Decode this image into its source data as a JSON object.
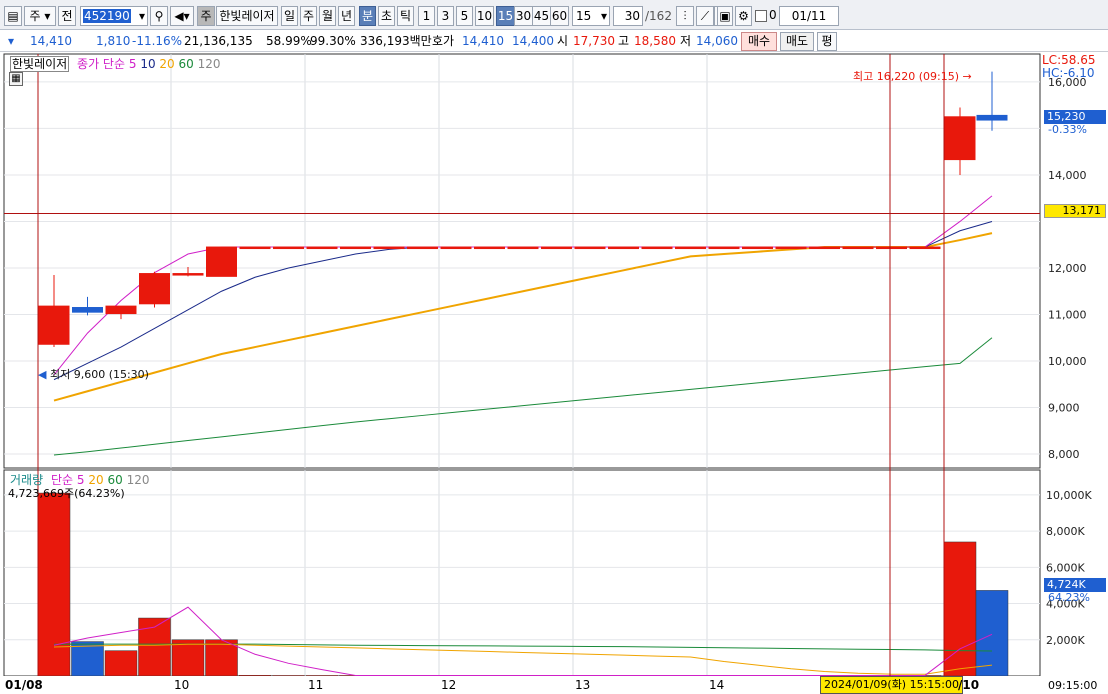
{
  "toolbar": {
    "period": "주",
    "prev": "전",
    "code": "452190",
    "stock_tag": "주",
    "stock_name": "한빛레이저",
    "periods": [
      "일",
      "주",
      "월",
      "년"
    ],
    "units": [
      "분",
      "초",
      "틱"
    ],
    "minutes": [
      "1",
      "3",
      "5",
      "10",
      "15",
      "30",
      "45",
      "60"
    ],
    "interval_value": "15",
    "count": "30",
    "count_total": "/162",
    "checkbox_label": "0",
    "date": "01/11"
  },
  "quote": {
    "price": "14,410",
    "change": "1,810",
    "change_pct": "-11.16%",
    "volume": "21,136,135",
    "ratio1": "58.99%",
    "ratio2": "99.30%",
    "amount": "336,193백만",
    "bid_label": "호가",
    "bid1": "14,410",
    "bid2": "14,400",
    "open_label": "시",
    "open": "17,730",
    "high_label": "고",
    "high": "18,580",
    "low_label": "저",
    "low": "14,060",
    "buy": "매수",
    "sell": "매도",
    "avg": "평"
  },
  "price_panel": {
    "stock_name": "한빛레이저",
    "ma_label": "종가 단순",
    "ma_periods": [
      "5",
      "10",
      "20",
      "60",
      "120"
    ],
    "high_note": "최고 16,220 (09:15)",
    "low_note": "최저 9,600 (15:30)",
    "lc": "LC:58.65",
    "hc": "HC:-6.10",
    "last_price": "15,230",
    "last_pct": "-0.33%",
    "hline_price": "13,171",
    "y_ticks": [
      "16,000",
      "14,000",
      "12,000",
      "11,000",
      "10,000",
      "9,000",
      "8,000"
    ]
  },
  "volume_panel": {
    "label": "거래량",
    "ma_label": "단순",
    "ma_periods": [
      "5",
      "20",
      "60",
      "120"
    ],
    "info": "4,723,669주(64.23%)",
    "last_volume": "4,724K",
    "last_pct": "64.23%",
    "y_ticks": [
      "10,000K",
      "8,000K",
      "6,000K",
      "4,000K",
      "2,000K"
    ]
  },
  "x_ticks": [
    "01/08",
    "10",
    "11",
    "12",
    "13",
    "14",
    "/10"
  ],
  "crosshair_time": "2024/01/09(화) 15:15:00",
  "clock": "09:15:00",
  "colors": {
    "up": "#e8180c",
    "down": "#1f5fd0",
    "ma5": "#d020c8",
    "ma10": "#1a2a8a",
    "ma20": "#f0a400",
    "ma60": "#1a8a3a",
    "crosshair": "#b01010"
  },
  "chart_data": {
    "type": "candlestick",
    "candles": [
      {
        "o": 10360,
        "h": 11850,
        "l": 10300,
        "c": 11180
      },
      {
        "o": 11150,
        "h": 11380,
        "l": 10980,
        "c": 11050
      },
      {
        "o": 11020,
        "h": 11150,
        "l": 10900,
        "c": 11180
      },
      {
        "o": 11230,
        "h": 11920,
        "l": 11150,
        "c": 11880
      },
      {
        "o": 11860,
        "h": 12020,
        "l": 11820,
        "c": 11880
      },
      {
        "o": 11820,
        "h": 12450,
        "l": 11820,
        "c": 12450
      },
      {
        "o": 12450,
        "h": 12450,
        "l": 12450,
        "c": 12450
      },
      {
        "o": 12450,
        "h": 12450,
        "l": 12450,
        "c": 12450
      },
      {
        "o": 12450,
        "h": 12450,
        "l": 12450,
        "c": 12450
      },
      {
        "o": 12450,
        "h": 12450,
        "l": 12450,
        "c": 12450
      },
      {
        "o": 12450,
        "h": 12450,
        "l": 12450,
        "c": 12450
      },
      {
        "o": 12450,
        "h": 12450,
        "l": 12450,
        "c": 12450
      },
      {
        "o": 12450,
        "h": 12450,
        "l": 12450,
        "c": 12450
      },
      {
        "o": 12450,
        "h": 12450,
        "l": 12450,
        "c": 12450
      },
      {
        "o": 12450,
        "h": 12450,
        "l": 12450,
        "c": 12450
      },
      {
        "o": 12450,
        "h": 12450,
        "l": 12450,
        "c": 12450
      },
      {
        "o": 12450,
        "h": 12450,
        "l": 12450,
        "c": 12450
      },
      {
        "o": 12450,
        "h": 12450,
        "l": 12450,
        "c": 12450
      },
      {
        "o": 12450,
        "h": 12450,
        "l": 12450,
        "c": 12450
      },
      {
        "o": 12450,
        "h": 12450,
        "l": 12450,
        "c": 12450
      },
      {
        "o": 12450,
        "h": 12450,
        "l": 12450,
        "c": 12450
      },
      {
        "o": 12450,
        "h": 12450,
        "l": 12450,
        "c": 12450
      },
      {
        "o": 12450,
        "h": 12450,
        "l": 12450,
        "c": 12450
      },
      {
        "o": 12450,
        "h": 12450,
        "l": 12450,
        "c": 12450
      },
      {
        "o": 12450,
        "h": 12450,
        "l": 12450,
        "c": 12450
      },
      {
        "o": 12450,
        "h": 12450,
        "l": 12450,
        "c": 12450
      },
      {
        "o": 12450,
        "h": 12450,
        "l": 12450,
        "c": 12450
      },
      {
        "o": 14330,
        "h": 15450,
        "l": 14000,
        "c": 15250
      },
      {
        "o": 15280,
        "h": 16220,
        "l": 14950,
        "c": 15180
      }
    ],
    "volume": [
      10100,
      1900,
      1400,
      3200,
      2000,
      2000,
      40,
      30,
      30,
      30,
      30,
      30,
      30,
      30,
      30,
      30,
      30,
      30,
      30,
      30,
      30,
      30,
      30,
      30,
      30,
      30,
      30,
      7400,
      4724
    ],
    "ma5": [
      9700,
      10600,
      11300,
      11900,
      12300,
      12450,
      12450,
      12450,
      12450,
      12450,
      12450,
      12450,
      12450,
      12450,
      12450,
      12450,
      12450,
      12450,
      12450,
      12450,
      12450,
      12450,
      12450,
      12450,
      12450,
      12450,
      12450,
      13000,
      13550
    ],
    "ma10": [
      9600,
      9950,
      10300,
      10700,
      11100,
      11500,
      11800,
      12000,
      12150,
      12300,
      12400,
      12450,
      12450,
      12450,
      12450,
      12450,
      12450,
      12450,
      12450,
      12450,
      12450,
      12450,
      12450,
      12450,
      12450,
      12450,
      12450,
      12800,
      13000
    ],
    "ma20": [
      9150,
      9350,
      9550,
      9750,
      9950,
      10150,
      10300,
      10450,
      10600,
      10750,
      10900,
      11050,
      11200,
      11350,
      11500,
      11650,
      11800,
      11950,
      12100,
      12250,
      12300,
      12350,
      12400,
      12450,
      12450,
      12450,
      12450,
      12600,
      12750
    ],
    "ma60": [
      7980,
      8050,
      8130,
      8210,
      8290,
      8370,
      8450,
      8530,
      8610,
      8690,
      8760,
      8830,
      8900,
      8970,
      9040,
      9110,
      9180,
      9250,
      9320,
      9390,
      9460,
      9530,
      9600,
      9670,
      9740,
      9810,
      9880,
      9950,
      10500
    ],
    "vol_ma5": [
      1700,
      2100,
      2400,
      2700,
      3800,
      2000,
      1200,
      700,
      350,
      30,
      30,
      30,
      30,
      30,
      30,
      30,
      30,
      30,
      30,
      30,
      30,
      30,
      30,
      30,
      30,
      30,
      30,
      1500,
      2300
    ],
    "vol_ma20": [
      1600,
      1650,
      1700,
      1700,
      1750,
      1750,
      1700,
      1650,
      1600,
      1550,
      1500,
      1450,
      1400,
      1350,
      1300,
      1250,
      1200,
      1150,
      1100,
      1050,
      800,
      600,
      400,
      250,
      150,
      100,
      100,
      400,
      600
    ],
    "vol_ma60": [
      1750,
      1760,
      1760,
      1760,
      1760,
      1760,
      1760,
      1740,
      1720,
      1700,
      1690,
      1680,
      1670,
      1660,
      1650,
      1640,
      1630,
      1620,
      1600,
      1580,
      1560,
      1540,
      1520,
      1500,
      1480,
      1460,
      1440,
      1400,
      1380
    ],
    "ylim": [
      7700,
      16600
    ],
    "vol_ylim": [
      0,
      10600
    ]
  }
}
